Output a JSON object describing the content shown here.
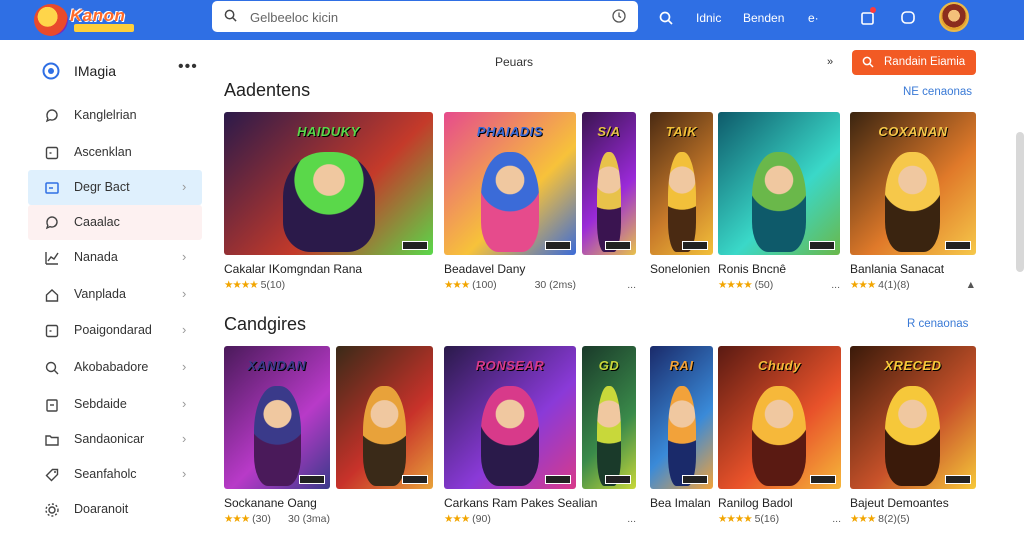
{
  "app": {
    "logo_text": "Kanon"
  },
  "search": {
    "placeholder": "Gelbeeloc kicin"
  },
  "topbar": {
    "links": [
      "Idnic",
      "Benden"
    ],
    "extra": "e·"
  },
  "sidebar": {
    "header": "IMagia",
    "more": "•••",
    "items": [
      {
        "label": "Kanglelrian",
        "icon": "chat-bubble-icon",
        "chevron": false
      },
      {
        "label": "Ascenklan",
        "icon": "square-icon",
        "chevron": false
      },
      {
        "label": "Degr Bact",
        "icon": "monitor-icon",
        "chevron": true,
        "selected": "blue"
      },
      {
        "label": "Caaalac",
        "icon": "chat-bubble-icon",
        "chevron": false,
        "selected": "pink"
      },
      {
        "label": "Nanada",
        "icon": "chart-icon",
        "chevron": true
      },
      {
        "label": "Vanplada",
        "icon": "home-icon",
        "chevron": true
      },
      {
        "label": "Poaigondarad",
        "icon": "square-icon",
        "chevron": true
      },
      {
        "label": "Akobabadore",
        "icon": "search-icon",
        "chevron": true
      },
      {
        "label": "Sebdaide",
        "icon": "clipboard-icon",
        "chevron": true
      },
      {
        "label": "Sandaonicar",
        "icon": "folder-icon",
        "chevron": true
      },
      {
        "label": "Seanfaholc",
        "icon": "tag-icon",
        "chevron": true
      },
      {
        "label": "Doaranoit",
        "icon": "gear-icon",
        "chevron": false
      }
    ]
  },
  "main": {
    "center_label": "Peuars",
    "nav_arrows": "»",
    "cta_label": "Randain Eiamia",
    "sections": [
      {
        "title": "Aadentens",
        "see_all": "NE cenaonas",
        "cards": [
          {
            "title": "Cakalar IKomgndan Rana",
            "stars": "★★★★",
            "rating": "5(10)",
            "extra": "",
            "art_text": "HAIDUKY",
            "colors": [
              "#2b1a4a",
              "#c43a2a",
              "#5ad84a"
            ]
          },
          {
            "title": "Beadavel Dany",
            "stars": "★★★",
            "rating": "(100)",
            "extra": "30 (2ms)",
            "art_text": "PHAIADIS",
            "colors": [
              "#e64b8c",
              "#f7c23a",
              "#3b6bd8"
            ]
          },
          {
            "title": "",
            "stars": "",
            "rating": "",
            "extra": "...",
            "art_text": "S/A",
            "colors": [
              "#3a1450",
              "#9a2ad8",
              "#e8c24a"
            ]
          },
          {
            "title": "Sonelonien",
            "stars": "",
            "rating": "",
            "extra": "",
            "art_text": "TAIK",
            "colors": [
              "#4a2a12",
              "#c87a2a",
              "#f2c03a"
            ]
          },
          {
            "title": "Ronis Bncnê",
            "stars": "★★★★",
            "rating": "(50)",
            "extra": "...",
            "art_text": "",
            "colors": [
              "#0e5a6a",
              "#3ad8c8",
              "#6ab84a"
            ]
          },
          {
            "title": "Banlania Sanacat",
            "stars": "★★★",
            "rating": "4(1)(8)",
            "extra": "▲",
            "art_text": "COXANAN",
            "colors": [
              "#3a2410",
              "#e07a2a",
              "#f6c84a"
            ]
          }
        ]
      },
      {
        "title": "Candgires",
        "see_all": "R cenaonas",
        "cards": [
          {
            "title": "Sockanane Oang",
            "stars": "★★★",
            "rating": "(30)",
            "extra": "30 (3ma)",
            "art_text": "XANDAN",
            "colors": [
              "#4a1a5a",
              "#b83ac8",
              "#3a3a8a"
            ]
          },
          {
            "title": "",
            "stars": "",
            "rating": "",
            "extra": "",
            "art_text": "",
            "colors": [
              "#3a2a18",
              "#c8322a",
              "#e8a23a"
            ]
          },
          {
            "title": "Carkans Ram Pakes Sealian",
            "stars": "★★★",
            "rating": "(90)",
            "extra": "",
            "art_text": "RONSEAR",
            "colors": [
              "#2a1a4a",
              "#8a3ad8",
              "#d83a8a"
            ]
          },
          {
            "title": "",
            "stars": "",
            "rating": "",
            "extra": "...",
            "art_text": "GD",
            "colors": [
              "#1a3a2a",
              "#3a8a4a",
              "#c8d83a"
            ]
          },
          {
            "title": "Bea Imalan",
            "stars": "",
            "rating": "",
            "extra": "",
            "art_text": "RAI",
            "colors": [
              "#1a2a6a",
              "#3a8ad8",
              "#f2a23a"
            ]
          },
          {
            "title": "Ranilog Badol",
            "stars": "★★★★",
            "rating": "5(16)",
            "extra": "...",
            "art_text": "Chudy",
            "colors": [
              "#5a1a12",
              "#e8522a",
              "#f6b83a"
            ]
          },
          {
            "title": "Bajeut Demoantes",
            "stars": "★★★",
            "rating": "8(2)(5)",
            "extra": "",
            "art_text": "XRECED",
            "colors": [
              "#3a1a0a",
              "#c8522a",
              "#f6c83a"
            ]
          }
        ]
      }
    ]
  },
  "colors": {
    "topbar": "#2f6fe4",
    "cta": "#f25a24",
    "link": "#3a7ad6",
    "star": "#f2a500"
  }
}
